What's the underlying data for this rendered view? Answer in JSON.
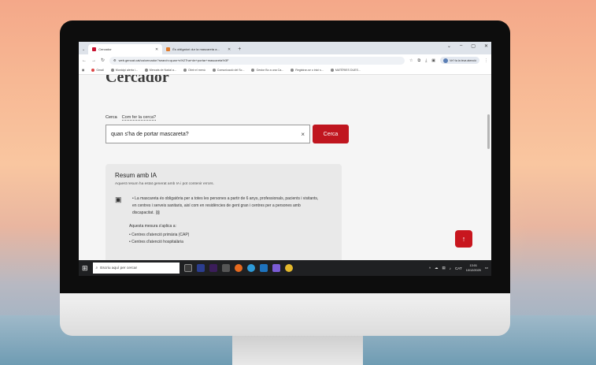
{
  "browser": {
    "tabs": [
      {
        "title": "Cercador",
        "active": true
      },
      {
        "title": "És obligatori dur la mascareta a...",
        "active": false
      }
    ],
    "new_tab": "+",
    "window_controls": [
      "⌄",
      "–",
      "▢",
      "✕"
    ],
    "url": "web.gencat.cat/ca/cercador?search=quan+s%27ha+de+portar+mascareta%3F",
    "profile_label": "Ve’l·la la teva atenció",
    "bookmarks": [
      "Gmail",
      "Municipi alerta i...",
      "Mercats de Nadal a...",
      "Obrir el menú",
      "Comunicació del Sc...",
      "Gestor Bo a una Ca...",
      "Registrar-se o inici s...",
      "MATÈRIES DUES..."
    ]
  },
  "page": {
    "heading": "Cercador",
    "search_label": "Cerca",
    "how_link": "Com fer la cerca?",
    "search_value": "quan s'ha de portar mascareta?",
    "clear_icon": "×",
    "search_button": "Cerca",
    "ai_summary": {
      "title": "Resum amb IA",
      "subtitle": "Aquest resum ha estat generat amb IA i pot contenir errors.",
      "bullet": "La mascareta és obligatòria per a totes les persones a partir de 6 anys, professionals, pacients i visitants, en centres i serveis sanitaris, així com en residències de gent gran i centres per a persones amb discapacitat.",
      "applies_label": "Aquesta mesura s'aplica a:",
      "applies_items": [
        "Centres d'atenció primària (CAP)",
        "Centres d'atenció hospitalària"
      ]
    }
  },
  "taskbar": {
    "search_placeholder": "Escriu aquí per cercar",
    "time": "13:01",
    "date": "10/12/2025",
    "language": "CAT"
  }
}
